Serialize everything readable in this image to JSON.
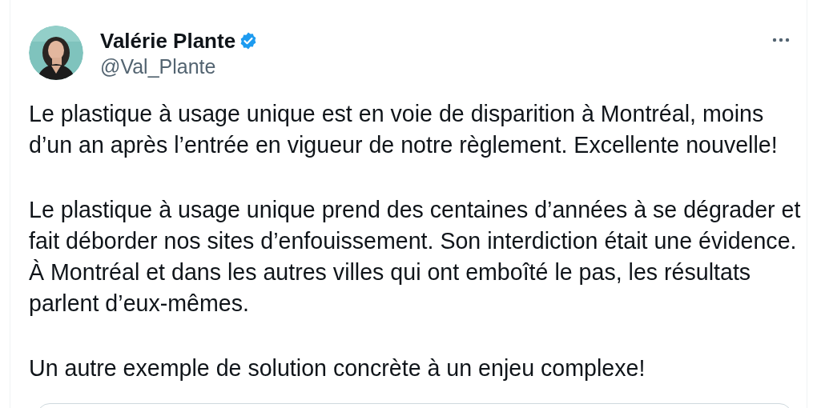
{
  "author": {
    "name": "Valérie Plante",
    "verified": true,
    "handle": "@Val_Plante"
  },
  "menu_icon": true,
  "paragraphs": [
    "Le plastique à usage unique est en voie de disparition à Montréal, moins d’un an après l’entrée en vigueur de notre règlement. Excellente nouvelle!",
    "Le plastique à usage unique prend des centaines d’années à se dégrader et fait déborder nos sites d’enfouissement. Son interdiction était une évidence. À Montréal et dans les autres villes qui ont emboîté le pas, les résultats parlent d’eux-mêmes.",
    "Un autre exemple de solution concrète à un enjeu complexe!"
  ],
  "embedded_card": true
}
